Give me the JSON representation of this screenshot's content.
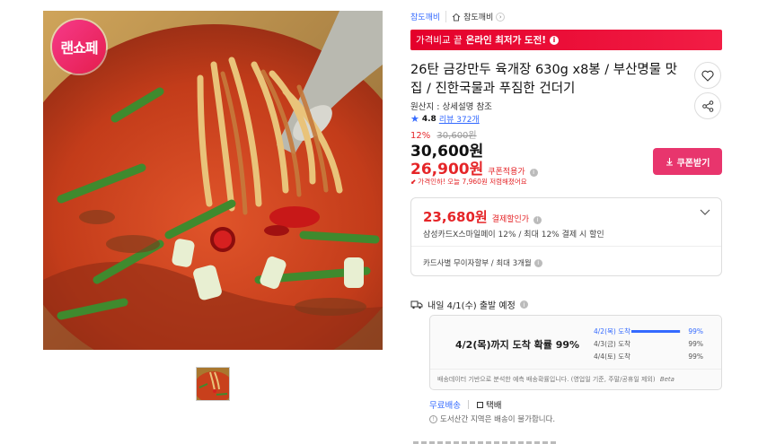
{
  "store": {
    "name": "참도깨비",
    "home_label": "참도깨비"
  },
  "promo": {
    "prefix": "가격비교 끝",
    "highlight": "온라인 최저가 도전!"
  },
  "badge": {
    "text": "랜쇼페"
  },
  "product": {
    "title": "26탄 금강만두 육개장 630g x8봉 / 부산명물 맛집 / 진한국물과 푸짐한 건더기",
    "origin": "원산지 : 상세설명 참조",
    "rating": "4.8",
    "review_count": "리뷰 372개"
  },
  "price": {
    "discount_rate": "12%",
    "original": "30,600원",
    "sale": "30,600원",
    "coupon_price": "26,900원",
    "coupon_label": "쿠폰적용가",
    "drop_note": "가격인하! 오늘 7,960원 저렴해졌어요",
    "coupon_button": "쿠폰받기"
  },
  "card": {
    "price": "23,680원",
    "label": "결제할인가",
    "desc": "삼성카드X스마일페이 12% / 최대 12% 결제 시 할인",
    "installment": "카드사별 무이자할부 / 최대 3개월"
  },
  "shipping": {
    "headline": "내일 4/1(수) 출발 예정",
    "prob_main": "4/2(목)까지 도착 확률 99%",
    "rows": [
      {
        "date": "4/2(목) 도착",
        "pct": "99%",
        "fill": 0.99
      },
      {
        "date": "4/3(금) 도착",
        "pct": "99%",
        "fill": 0.99
      },
      {
        "date": "4/4(토) 도착",
        "pct": "99%",
        "fill": 0.99
      }
    ],
    "footnote": "배송데이터 기반으로 분석한 예측 배송확률입니다. (영업일 기준, 주말/공휴일 제외)",
    "beta": "Beta",
    "free_label": "무료배송",
    "type_label": "택배",
    "island_note": "도서산간 지역은 배송이 불가합니다."
  },
  "colors": {
    "price_red": "#e52528",
    "coupon_pink": "#e8356d",
    "link_blue": "#346aff",
    "promo_red": "#e4002b"
  }
}
